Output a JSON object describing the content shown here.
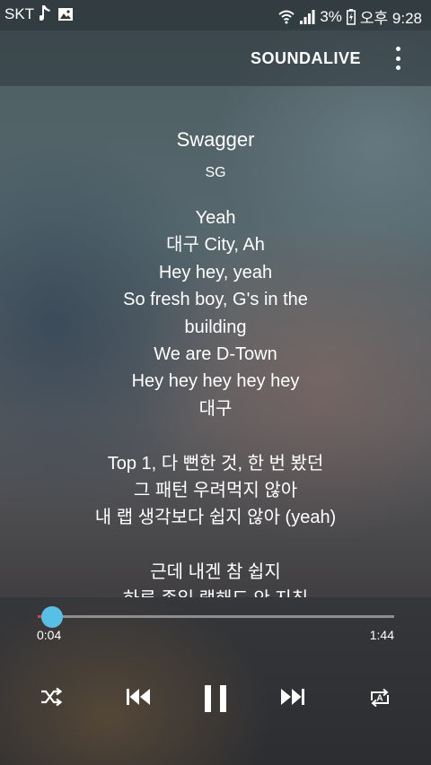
{
  "status_bar": {
    "carrier": "SKT",
    "battery_percent": "3%",
    "time": "오후 9:28"
  },
  "app_bar": {
    "soundalive_label": "SOUNDALIVE",
    "more_icon": "more-vert-icon"
  },
  "song": {
    "title": "Swagger",
    "artist": "SG"
  },
  "lyrics": [
    "Yeah",
    "대구 City, Ah",
    "Hey hey, yeah",
    "So fresh boy, G's in the",
    "building",
    "We are D-Town",
    "Hey hey hey hey hey",
    "대구",
    "",
    "Top 1, 다 뻔한 것, 한 번 봤던",
    "그 패턴 우려먹지 않아",
    "내 랩 생각보다 쉽지 않아 (yeah)",
    "",
    "근데 내겐 참 쉽지",
    "하루 종일 랩해도 안 지침"
  ],
  "player": {
    "current_time": "0:04",
    "total_time": "1:44",
    "progress_fraction": 0.04,
    "accent_color": "#58c0e6",
    "icons": [
      "shuffle-icon",
      "previous-icon",
      "pause-icon",
      "next-icon",
      "repeat-a-icon"
    ]
  }
}
